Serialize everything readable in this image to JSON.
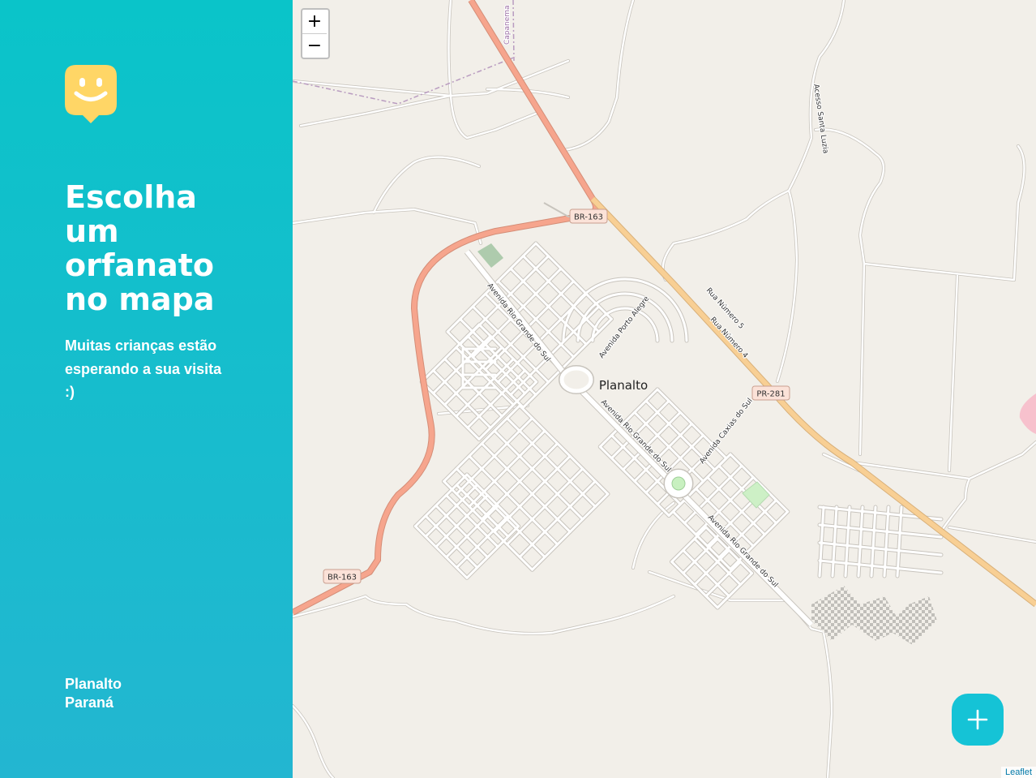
{
  "sidebar": {
    "logo_icon": "happy-map-marker-icon",
    "title_lines": [
      "Escolha",
      "um",
      "orfanato",
      "no mapa"
    ],
    "subtitle_lines": [
      "Muitas crianças estão",
      "esperando a sua visita",
      ":)"
    ],
    "city": "Planalto",
    "state": "Paraná"
  },
  "map": {
    "zoom_in_label": "+",
    "zoom_out_label": "−",
    "attribution": "Leaflet",
    "labels": {
      "town": "Planalto",
      "br163_top": "BR-163",
      "br163_left": "BR-163",
      "pr281": "PR-281",
      "av_rio_grande_1": "Avenida Rio Grande do Sul",
      "av_rio_grande_2": "Avenida Rio Grande do Sul",
      "av_rio_grande_3": "Avenida Rio Grande do Sul",
      "av_porto_alegre": "Avenida Porto Alegre",
      "av_caxias": "Avenida Caxias do Sul",
      "rua_5": "Rua Número 5",
      "rua_4": "Rua Número 4",
      "acesso": "Acesso Santa Luzia",
      "capanema": "Capanema"
    }
  },
  "fab": {
    "icon": "plus-icon"
  },
  "colors": {
    "sidebar_top": "#0ac4c9",
    "sidebar_bottom": "#23b6d1",
    "logo": "#ffd666",
    "fab": "#15c3d6",
    "trunk_road": "#f6a58d",
    "primary_road": "#f8cf94"
  }
}
